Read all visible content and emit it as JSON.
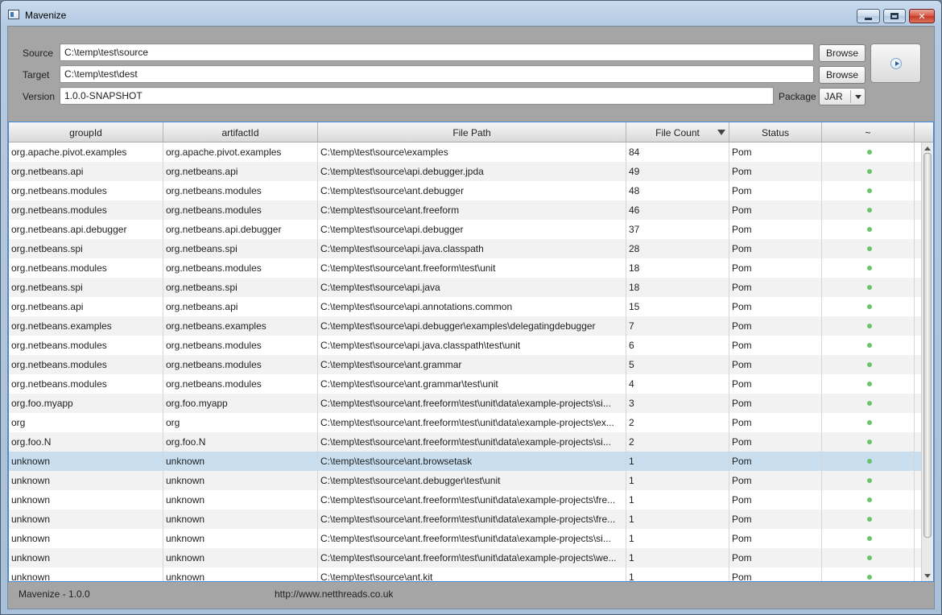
{
  "window": {
    "title": "Mavenize"
  },
  "form": {
    "source_label": "Source",
    "source_value": "C:\\temp\\test\\source",
    "target_label": "Target",
    "target_value": "C:\\temp\\test\\dest",
    "version_label": "Version",
    "version_value": "1.0.0-SNAPSHOT",
    "browse_label": "Browse",
    "package_label": "Package",
    "package_value": "JAR"
  },
  "table": {
    "columns": [
      "groupId",
      "artifactId",
      "File Path",
      "File Count",
      "Status",
      "~"
    ],
    "sorted_column": "File Count",
    "status_dot_color": "#6cc26c",
    "selected_row": 16,
    "rows": [
      [
        "org.apache.pivot.examples",
        "org.apache.pivot.examples",
        "C:\\temp\\test\\source\\examples",
        "84",
        "Pom"
      ],
      [
        "org.netbeans.api",
        "org.netbeans.api",
        "C:\\temp\\test\\source\\api.debugger.jpda",
        "49",
        "Pom"
      ],
      [
        "org.netbeans.modules",
        "org.netbeans.modules",
        "C:\\temp\\test\\source\\ant.debugger",
        "48",
        "Pom"
      ],
      [
        "org.netbeans.modules",
        "org.netbeans.modules",
        "C:\\temp\\test\\source\\ant.freeform",
        "46",
        "Pom"
      ],
      [
        "org.netbeans.api.debugger",
        "org.netbeans.api.debugger",
        "C:\\temp\\test\\source\\api.debugger",
        "37",
        "Pom"
      ],
      [
        "org.netbeans.spi",
        "org.netbeans.spi",
        "C:\\temp\\test\\source\\api.java.classpath",
        "28",
        "Pom"
      ],
      [
        "org.netbeans.modules",
        "org.netbeans.modules",
        "C:\\temp\\test\\source\\ant.freeform\\test\\unit",
        "18",
        "Pom"
      ],
      [
        "org.netbeans.spi",
        "org.netbeans.spi",
        "C:\\temp\\test\\source\\api.java",
        "18",
        "Pom"
      ],
      [
        "org.netbeans.api",
        "org.netbeans.api",
        "C:\\temp\\test\\source\\api.annotations.common",
        "15",
        "Pom"
      ],
      [
        "org.netbeans.examples",
        "org.netbeans.examples",
        "C:\\temp\\test\\source\\api.debugger\\examples\\delegatingdebugger",
        "7",
        "Pom"
      ],
      [
        "org.netbeans.modules",
        "org.netbeans.modules",
        "C:\\temp\\test\\source\\api.java.classpath\\test\\unit",
        "6",
        "Pom"
      ],
      [
        "org.netbeans.modules",
        "org.netbeans.modules",
        "C:\\temp\\test\\source\\ant.grammar",
        "5",
        "Pom"
      ],
      [
        "org.netbeans.modules",
        "org.netbeans.modules",
        "C:\\temp\\test\\source\\ant.grammar\\test\\unit",
        "4",
        "Pom"
      ],
      [
        "org.foo.myapp",
        "org.foo.myapp",
        "C:\\temp\\test\\source\\ant.freeform\\test\\unit\\data\\example-projects\\si...",
        "3",
        "Pom"
      ],
      [
        "org",
        "org",
        "C:\\temp\\test\\source\\ant.freeform\\test\\unit\\data\\example-projects\\ex...",
        "2",
        "Pom"
      ],
      [
        "org.foo.N",
        "org.foo.N",
        "C:\\temp\\test\\source\\ant.freeform\\test\\unit\\data\\example-projects\\si...",
        "2",
        "Pom"
      ],
      [
        "unknown",
        "unknown",
        "C:\\temp\\test\\source\\ant.browsetask",
        "1",
        "Pom"
      ],
      [
        "unknown",
        "unknown",
        "C:\\temp\\test\\source\\ant.debugger\\test\\unit",
        "1",
        "Pom"
      ],
      [
        "unknown",
        "unknown",
        "C:\\temp\\test\\source\\ant.freeform\\test\\unit\\data\\example-projects\\fre...",
        "1",
        "Pom"
      ],
      [
        "unknown",
        "unknown",
        "C:\\temp\\test\\source\\ant.freeform\\test\\unit\\data\\example-projects\\fre...",
        "1",
        "Pom"
      ],
      [
        "unknown",
        "unknown",
        "C:\\temp\\test\\source\\ant.freeform\\test\\unit\\data\\example-projects\\si...",
        "1",
        "Pom"
      ],
      [
        "unknown",
        "unknown",
        "C:\\temp\\test\\source\\ant.freeform\\test\\unit\\data\\example-projects\\we...",
        "1",
        "Pom"
      ],
      [
        "unknown",
        "unknown",
        "C:\\temp\\test\\source\\ant.kit",
        "1",
        "Pom"
      ]
    ]
  },
  "icons": {
    "app": "app-window-icon",
    "run": "play-icon",
    "sort": "sort-descending-icon",
    "status": "status-dot-icon"
  },
  "status_bar": {
    "app_version": "Mavenize - 1.0.0",
    "url": "http://www.netthreads.co.uk"
  }
}
